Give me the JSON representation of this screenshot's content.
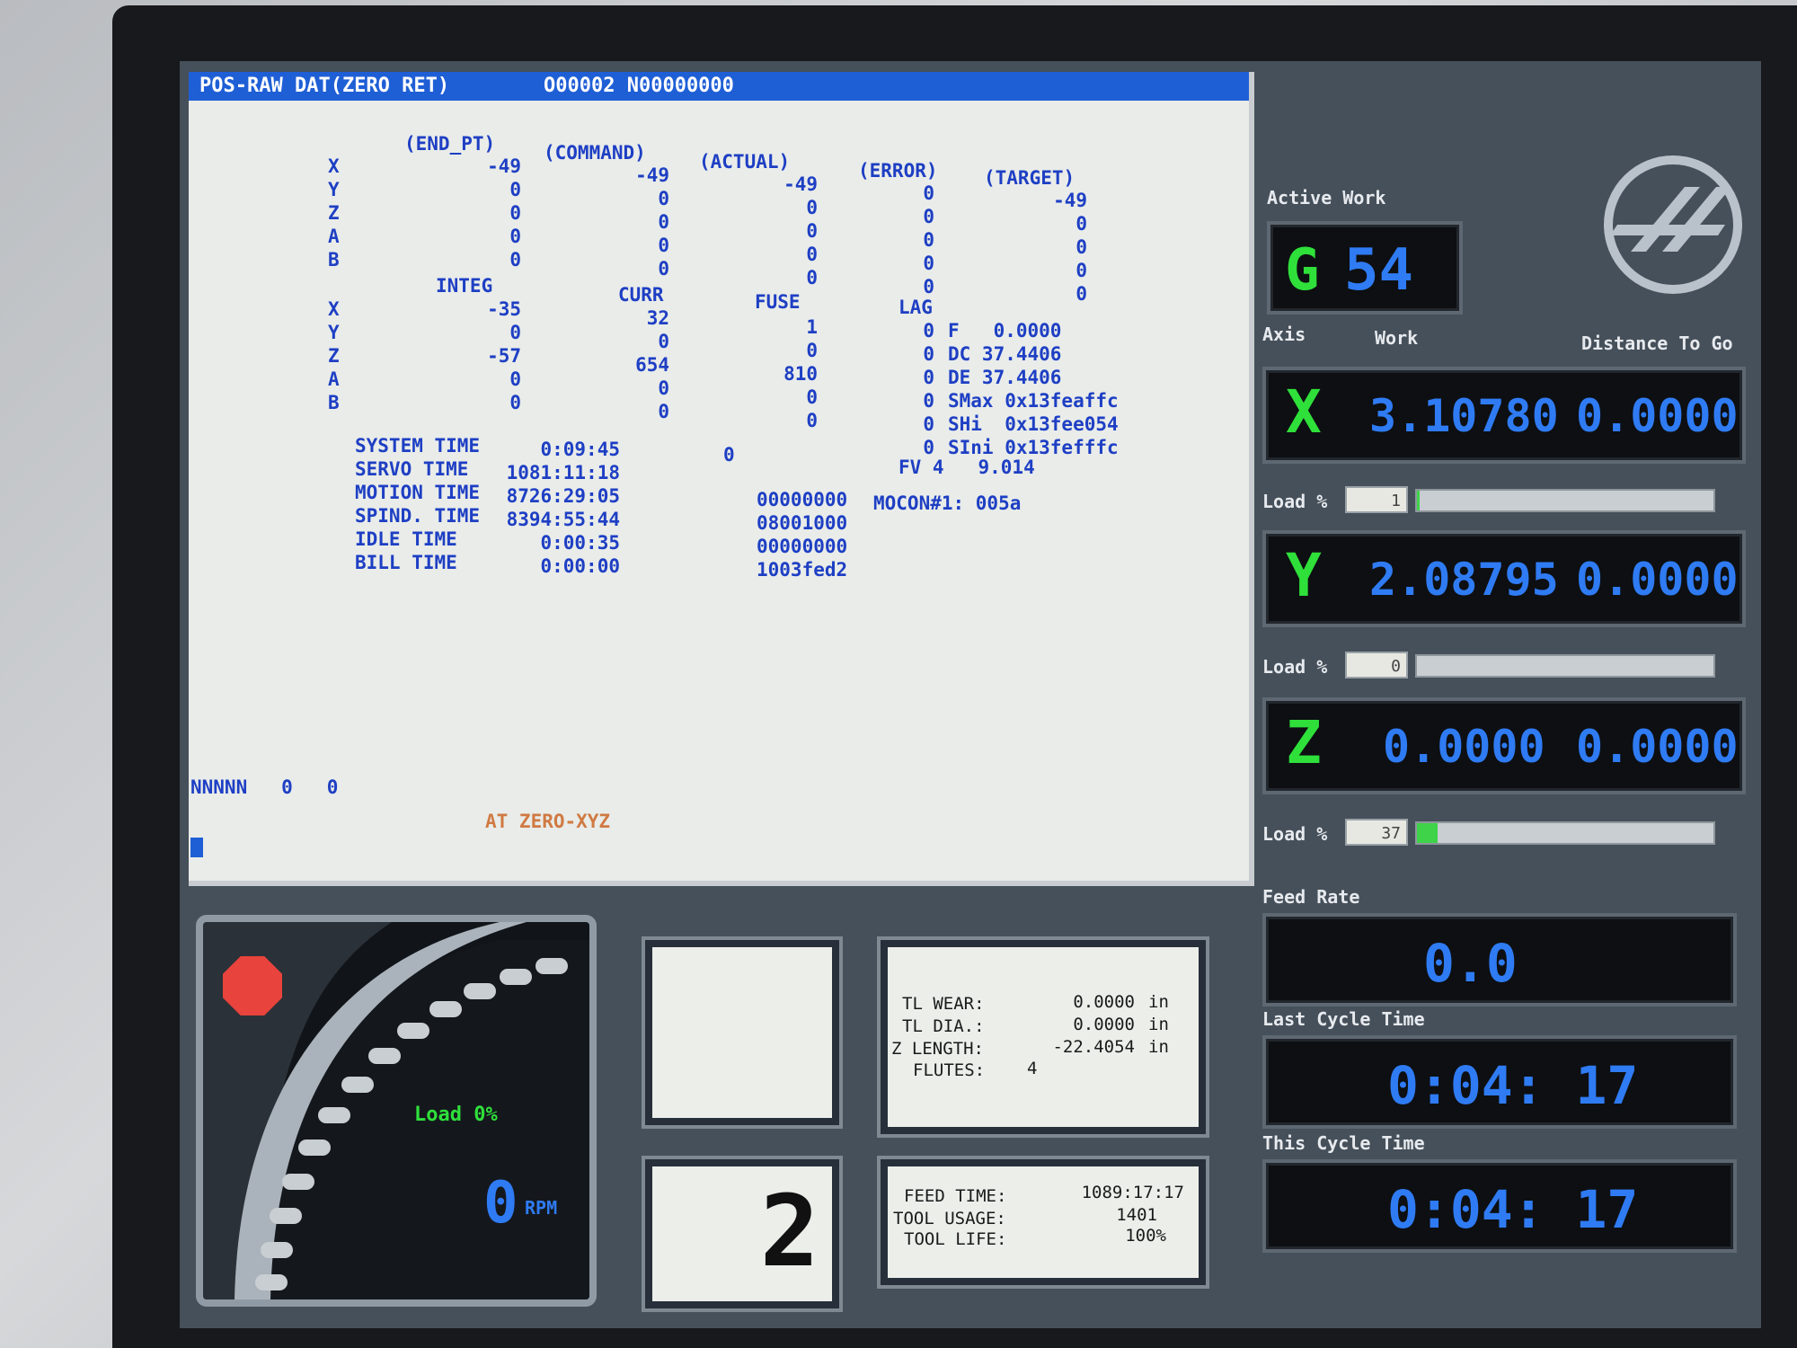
{
  "title_bar": {
    "mode": "POS-RAW DAT(ZERO RET)",
    "program": "O00002 N00000000"
  },
  "position_table": {
    "headers": [
      "(END_PT)",
      "(COMMAND)",
      "(ACTUAL)",
      "(ERROR)",
      "(TARGET)"
    ],
    "rows": [
      {
        "axis": "X",
        "end_pt": "-49",
        "command": "-49",
        "actual": "-49",
        "error": "0",
        "target": "-49"
      },
      {
        "axis": "Y",
        "end_pt": "0",
        "command": "0",
        "actual": "0",
        "error": "0",
        "target": "0"
      },
      {
        "axis": "Z",
        "end_pt": "0",
        "command": "0",
        "actual": "0",
        "error": "0",
        "target": "0"
      },
      {
        "axis": "A",
        "end_pt": "0",
        "command": "0",
        "actual": "0",
        "error": "0",
        "target": "0"
      },
      {
        "axis": "B",
        "end_pt": "0",
        "command": "0",
        "actual": "0",
        "error": "0",
        "target": "0"
      }
    ]
  },
  "servo_table": {
    "headers": [
      "INTEG",
      "CURR",
      "FUSE",
      "LAG"
    ],
    "rows": [
      {
        "axis": "X",
        "integ": "-35",
        "curr": "32",
        "fuse": "1",
        "lag": "0",
        "param": "F   0.0000"
      },
      {
        "axis": "Y",
        "integ": "0",
        "curr": "0",
        "fuse": "0",
        "lag": "0",
        "param": "DC 37.4406"
      },
      {
        "axis": "Z",
        "integ": "-57",
        "curr": "654",
        "fuse": "810",
        "lag": "0",
        "param": "DE 37.4406"
      },
      {
        "axis": "A",
        "integ": "0",
        "curr": "0",
        "fuse": "0",
        "lag": "0",
        "param": "SMax 0x13feaffc"
      },
      {
        "axis": "B",
        "integ": "0",
        "curr": "0",
        "fuse": "0",
        "lag": "0",
        "param": "SHi  0x13fee054"
      }
    ],
    "extra_param": {
      "lag": "0",
      "param": "SIni 0x13fefffc"
    }
  },
  "times": [
    {
      "label": "SYSTEM TIME",
      "value": "0:09:45",
      "aux": "0"
    },
    {
      "label": "SERVO TIME",
      "value": "1081:11:18",
      "aux": ""
    },
    {
      "label": "MOTION TIME",
      "value": "8726:29:05",
      "aux": "00000000"
    },
    {
      "label": "SPIND. TIME",
      "value": "8394:55:44",
      "aux": "08001000"
    },
    {
      "label": "IDLE TIME",
      "value": "0:00:35",
      "aux": "00000000"
    },
    {
      "label": "BILL TIME",
      "value": "0:00:00",
      "aux": "1003fed2"
    }
  ],
  "fv_line": "FV 4   9.014",
  "mocon": "MOCON#1: 005a",
  "nnnnn_line": "NNNNN   0   0",
  "status_message": "AT ZERO-XYZ",
  "right_panel": {
    "active_work_label": "Active Work",
    "work_g": "G",
    "work_offset": "54",
    "axis_label": "Axis",
    "work_label": "Work",
    "dtg_label": "Distance To Go",
    "load_label": "Load %",
    "axes": [
      {
        "axis": "X",
        "work": "3.10780",
        "dtg": "0.0000",
        "load": "1",
        "load_fraction": 0.01
      },
      {
        "axis": "Y",
        "work": "2.08795",
        "dtg": "0.0000",
        "load": "0",
        "load_fraction": 0.0
      },
      {
        "axis": "Z",
        "work": "0.0000",
        "dtg": "0.0000",
        "load": "37",
        "load_fraction": 0.07
      }
    ],
    "feed_rate_label": "Feed Rate",
    "feed_rate": "0.0",
    "last_cycle_label": "Last Cycle Time",
    "last_cycle": "0:04: 17",
    "this_cycle_label": "This Cycle Time",
    "this_cycle": "0:04: 17"
  },
  "spindle": {
    "load_text": "Load 0%",
    "rpm": "0",
    "rpm_unit": "RPM"
  },
  "tool_number": "2",
  "tool_info": [
    {
      "label": "TL WEAR:",
      "value": "0.0000",
      "unit": "in"
    },
    {
      "label": "TL DIA.:",
      "value": "0.0000",
      "unit": "in"
    },
    {
      "label": "Z LENGTH:",
      "value": "-22.4054",
      "unit": "in"
    },
    {
      "label": "FLUTES:",
      "value": "4",
      "unit": ""
    }
  ],
  "tool_life_info": [
    {
      "label": "FEED TIME:",
      "value": "1089:17:17"
    },
    {
      "label": "TOOL USAGE:",
      "value": "1401"
    },
    {
      "label": "TOOL LIFE:",
      "value": "100%"
    }
  ],
  "colors": {
    "title_blue": "#1f5fd6",
    "text_blue": "#1e3fc4",
    "status_orange": "#d07a43",
    "lcd_blue": "#2f7bf3",
    "axis_green": "#2fe03a",
    "stop_red": "#e8433c"
  }
}
